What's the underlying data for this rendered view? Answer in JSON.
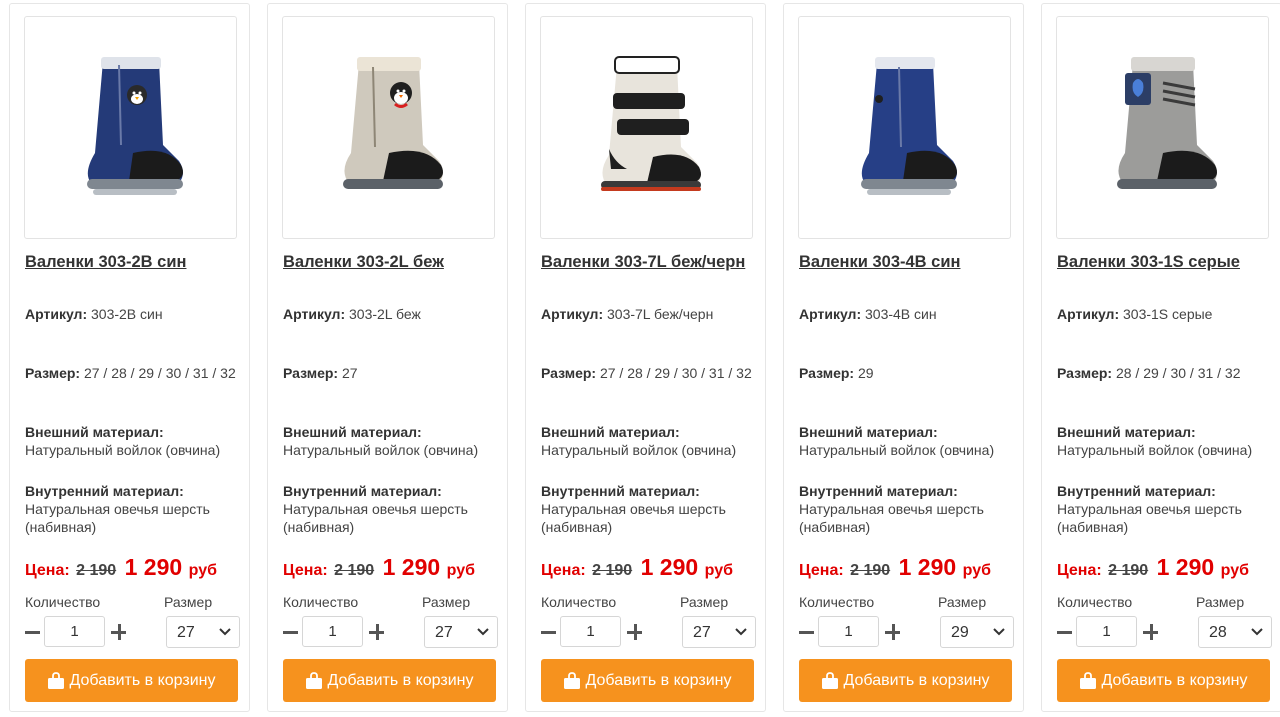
{
  "labels": {
    "article": "Артикул:",
    "size": "Размер:",
    "outer_material": "Внешний материал:",
    "inner_material": "Внутренний материал:",
    "price": "Цена:",
    "currency": "руб",
    "quantity": "Количество",
    "size_select": "Размер",
    "add_to_cart": "Добавить в корзину"
  },
  "colors": {
    "accent_button": "#f6921e",
    "price_red": "#e10000"
  },
  "products": [
    {
      "title": "Валенки 303-2В син",
      "article": "303-2В син",
      "sizes": "27 / 28 / 29 / 30 / 31 / 32",
      "outer_material": "Натуральный войлок (овчина)",
      "inner_material": "Натуральная овечья шерсть (набивная)",
      "old_price": "2 190",
      "new_price": "1 290",
      "quantity": "1",
      "selected_size": "27",
      "image": "blue-felt-boot-penguin"
    },
    {
      "title": "Валенки 303-2L беж",
      "article": "303-2L беж",
      "sizes": "27",
      "outer_material": "Натуральный войлок (овчина)",
      "inner_material": "Натуральная овечья шерсть (набивная)",
      "old_price": "2 190",
      "new_price": "1 290",
      "quantity": "1",
      "selected_size": "27",
      "image": "beige-felt-boot-penguin"
    },
    {
      "title": "Валенки 303-7L беж/черн",
      "article": "303-7L беж/черн",
      "sizes": "27 / 28 / 29 / 30 / 31 / 32",
      "outer_material": "Натуральный войлок (овчина)",
      "inner_material": "Натуральная овечья шерсть (набивная)",
      "old_price": "2 190",
      "new_price": "1 290",
      "quantity": "1",
      "selected_size": "27",
      "image": "beige-black-strap-boot"
    },
    {
      "title": "Валенки 303-4В син",
      "article": "303-4В син",
      "sizes": "29",
      "outer_material": "Натуральный войлок (овчина)",
      "inner_material": "Натуральная овечья шерсть (набивная)",
      "old_price": "2 190",
      "new_price": "1 290",
      "quantity": "1",
      "selected_size": "29",
      "image": "blue-felt-boot"
    },
    {
      "title": "Валенки 303-1S серые",
      "article": "303-1S серые",
      "sizes": "28 / 29 / 30 / 31 / 32",
      "outer_material": "Натуральный войлок (овчина)",
      "inner_material": "Натуральная овечья шерсть (набивная)",
      "old_price": "2 190",
      "new_price": "1 290",
      "quantity": "1",
      "selected_size": "28",
      "image": "grey-felt-boot-rabbit"
    }
  ]
}
